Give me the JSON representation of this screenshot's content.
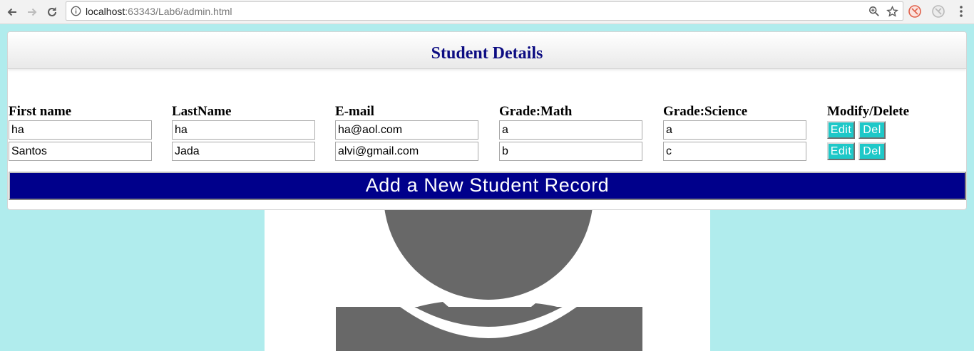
{
  "browser": {
    "url_host": "localhost",
    "url_rest": ":63343/Lab6/admin.html"
  },
  "page": {
    "title": "Student Details",
    "columns": [
      "First name",
      "LastName",
      "E-mail",
      "Grade:Math",
      "Grade:Science",
      "Modify/Delete"
    ],
    "rows": [
      {
        "first": "ha",
        "last": "ha",
        "email": "ha@aol.com",
        "math": "a",
        "science": "a"
      },
      {
        "first": "Santos",
        "last": "Jada",
        "email": "alvi@gmail.com",
        "math": "b",
        "science": "c"
      }
    ],
    "edit_label": "Edit",
    "del_label": "Del",
    "add_label": "Add a New Student Record",
    "colors": {
      "page_bg": "#b0eced",
      "title_color": "#0c0c82",
      "button_accent": "#1ec8c8",
      "add_button_bg": "#00008b",
      "avatar_gray": "#686868"
    }
  }
}
